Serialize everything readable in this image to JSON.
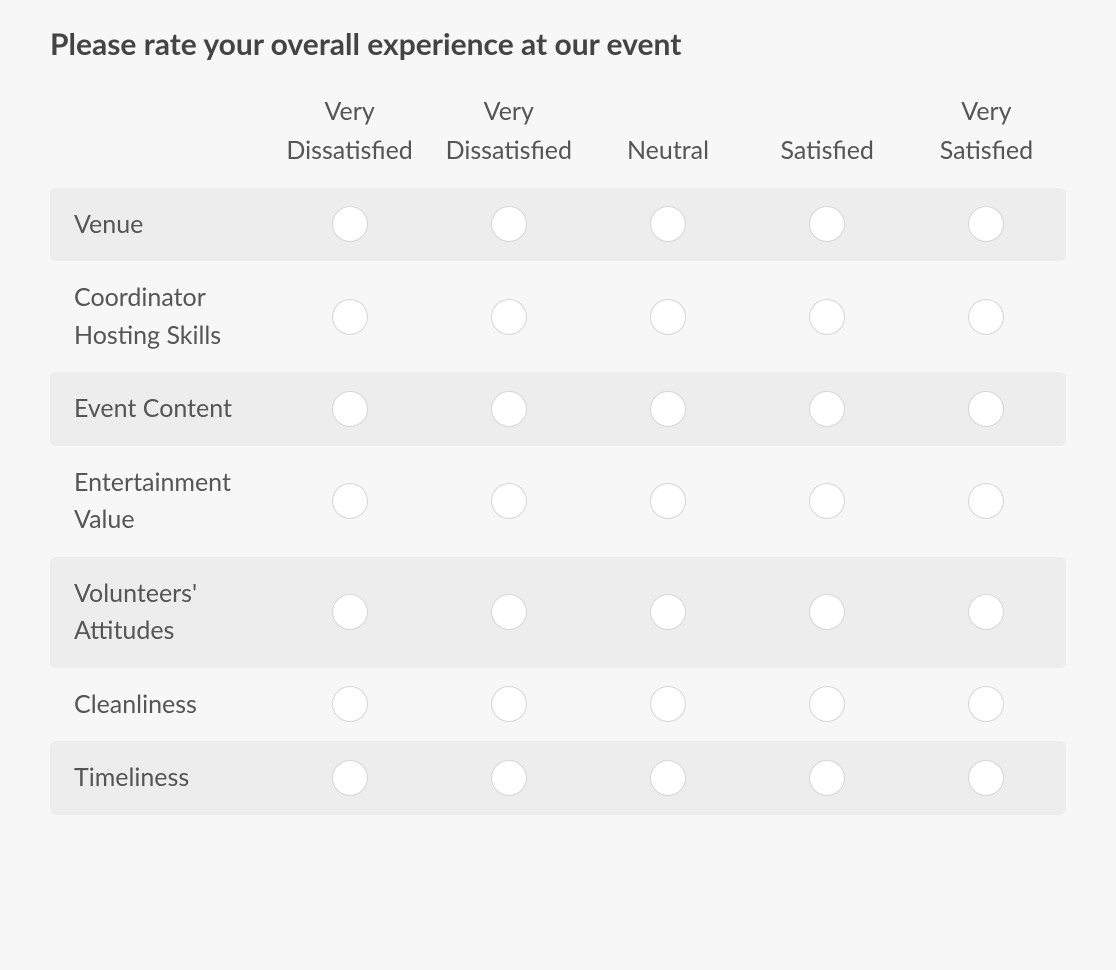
{
  "title": "Please rate your overall experience at our event",
  "columns": [
    "Very Dissatisfied",
    "Very Dissatisfied",
    "Neutral",
    "Satisfied",
    "Very Satisfied"
  ],
  "rows": [
    "Venue",
    "Coordinator Hosting Skills",
    "Event Content",
    "Entertainment Value",
    "Volunteers' Attitudes",
    "Cleanliness",
    "Timeliness"
  ]
}
